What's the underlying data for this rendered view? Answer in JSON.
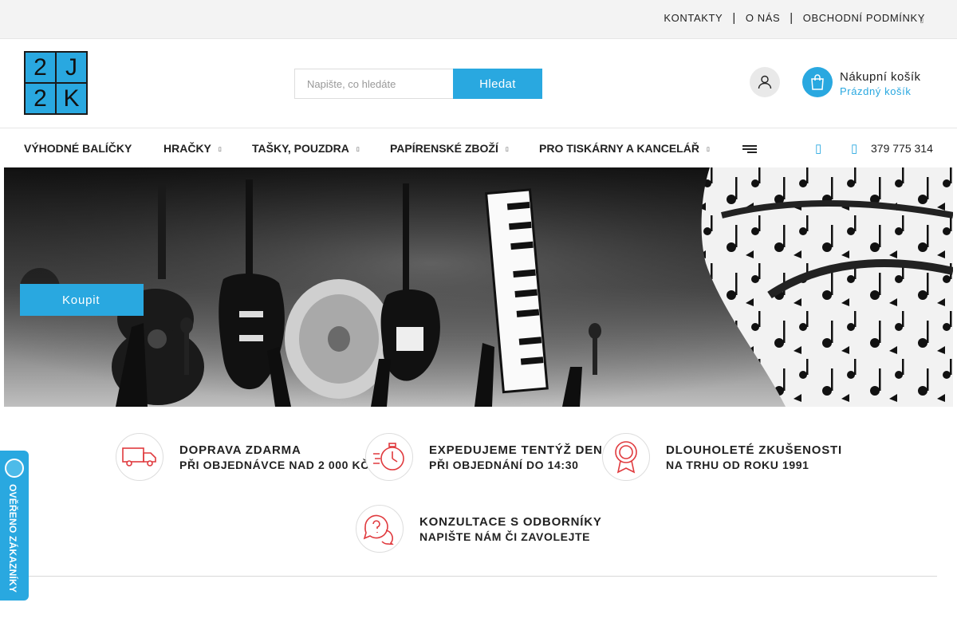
{
  "topbar": {
    "links": [
      "KONTAKTY",
      "O NÁS",
      "OBCHODNÍ PODMÍNKY"
    ],
    "separator": "|"
  },
  "logo": {
    "cells": [
      "2",
      "J",
      "2",
      "K"
    ]
  },
  "search": {
    "placeholder": "Napište, co hledáte",
    "button_label": "Hledat"
  },
  "cart": {
    "title": "Nákupní košík",
    "status": "Prázdný košík"
  },
  "nav": {
    "items": [
      {
        "label": "VÝHODNÉ BALÍČKY",
        "has_submenu": false
      },
      {
        "label": "HRAČKY",
        "has_submenu": true
      },
      {
        "label": "TAŠKY, POUZDRA",
        "has_submenu": true
      },
      {
        "label": "PAPÍRENSKÉ ZBOŽÍ",
        "has_submenu": true
      },
      {
        "label": "PRO TISKÁRNY A KANCELÁŘ",
        "has_submenu": true
      }
    ],
    "phone": "379 775 314"
  },
  "hero": {
    "button_label": "Koupit"
  },
  "features": [
    {
      "title": "DOPRAVA ZDARMA",
      "subtitle": "PŘI OBJEDNÁVCE NAD 2 000 KČ",
      "icon": "delivery-truck-icon"
    },
    {
      "title": "EXPEDUJEME TENTÝŽ DEN",
      "subtitle": "PŘI OBJEDNÁNÍ DO 14:30",
      "icon": "stopwatch-icon"
    },
    {
      "title": "DLOUHOLETÉ ZKUŠENOSTI",
      "subtitle": "NA TRHU OD ROKU 1991",
      "icon": "award-ribbon-icon"
    },
    {
      "title": "KONZULTACE S ODBORNÍKY",
      "subtitle": "NAPIŠTE NÁM ČI ZAVOLEJTE",
      "icon": "chat-question-icon"
    }
  ],
  "verified_badge": {
    "label": "OVĚŘENO ZÁKAZNÍKY"
  },
  "colors": {
    "accent": "#29a8e0",
    "feature_icon": "#e03a3e"
  }
}
